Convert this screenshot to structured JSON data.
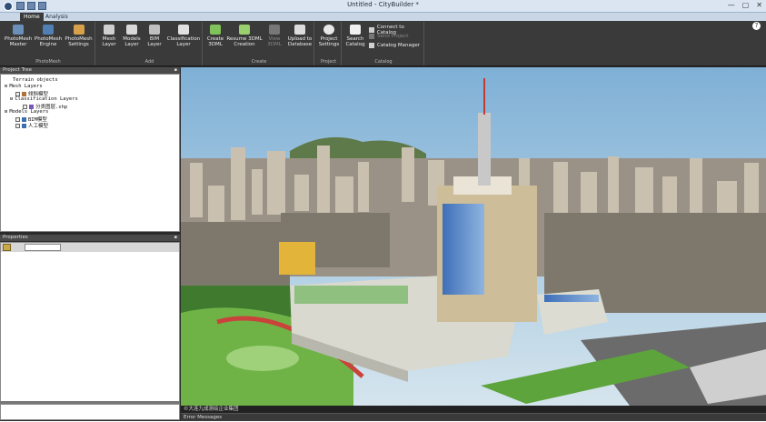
{
  "window": {
    "title": "Untitled - CityBuilder *",
    "controls": [
      "—",
      "▢",
      "✕"
    ]
  },
  "tabs": [
    {
      "label": "Home"
    },
    {
      "label": "Analysis"
    }
  ],
  "ribbon": {
    "photomesh": {
      "label": "PhotoMesh",
      "buttons": [
        {
          "label": "PhotoMesh\nMaster"
        },
        {
          "label": "PhotoMesh\nEngine"
        },
        {
          "label": "PhotoMesh\nSettings"
        }
      ]
    },
    "add": {
      "label": "Add",
      "buttons": [
        {
          "label": "Mesh\nLayer"
        },
        {
          "label": "Models\nLayer"
        },
        {
          "label": "BIM\nLayer"
        },
        {
          "label": "Classification\nLayer"
        }
      ]
    },
    "create": {
      "label": "Create",
      "buttons": [
        {
          "label": "Create\n3DML"
        },
        {
          "label": "Resume 3DML\nCreation"
        },
        {
          "label": "View\n3DML"
        },
        {
          "label": "Upload to\nDatabase"
        }
      ]
    },
    "project": {
      "label": "Project",
      "buttons": [
        {
          "label": "Project\nSettings"
        }
      ]
    },
    "catalog": {
      "label": "Catalog",
      "search": {
        "label": "Search\nCatalog"
      },
      "small": [
        {
          "label": "Connect to Catalog"
        },
        {
          "label": "Send Project"
        },
        {
          "label": "Catalog Manager"
        }
      ]
    }
  },
  "project_tree": {
    "title": "Project Tree",
    "rows": [
      {
        "label": "Terrain objects",
        "checkbox": false
      },
      {
        "label": "Mesh Layers",
        "checkbox": false
      },
      {
        "label": "倾斜模型",
        "checkbox": true
      },
      {
        "label": "Classification Layers",
        "checkbox": false
      },
      {
        "label": "分类图层.shp",
        "checkbox": true
      },
      {
        "label": "Models Layers",
        "checkbox": false
      },
      {
        "label": "BIM模型",
        "checkbox": true
      },
      {
        "label": "人工模型",
        "checkbox": true
      }
    ]
  },
  "properties": {
    "title": "Properties"
  },
  "status": {
    "watermark": "©大连九成测绘企业集团",
    "bottom_label": "Error Messages"
  },
  "colors": {
    "accent": "#2e4f7a",
    "ribbon_bg": "#3a3a3a",
    "sky": "#8eb8d9"
  }
}
